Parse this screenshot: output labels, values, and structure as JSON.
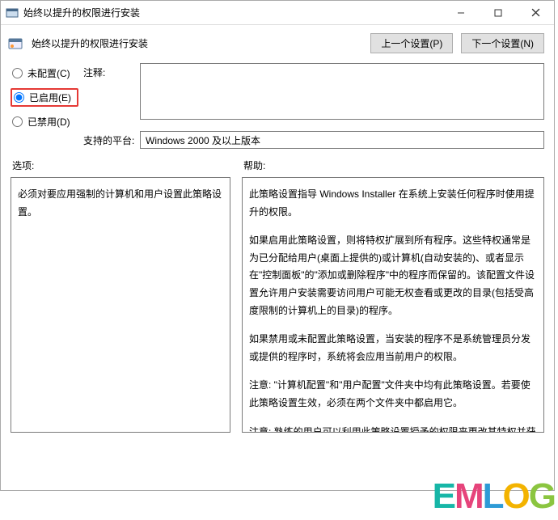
{
  "titlebar": {
    "title": "始终以提升的权限进行安装"
  },
  "header": {
    "title": "始终以提升的权限进行安装",
    "prev_btn": "上一个设置(P)",
    "next_btn": "下一个设置(N)"
  },
  "radios": {
    "not_configured": "未配置(C)",
    "enabled": "已启用(E)",
    "disabled": "已禁用(D)"
  },
  "fields": {
    "comment_label": "注释:",
    "platform_label": "支持的平台:",
    "platform_value": "Windows 2000 及以上版本"
  },
  "panes": {
    "options_label": "选项:",
    "options_text": "必须对要应用强制的计算机和用户设置此策略设置。",
    "help_label": "帮助:",
    "help_p1": "此策略设置指导 Windows Installer 在系统上安装任何程序时使用提升的权限。",
    "help_p2": "如果启用此策略设置，则将特权扩展到所有程序。这些特权通常是为已分配给用户(桌面上提供的)或计算机(自动安装的)、或者显示在\"控制面板\"的\"添加或删除程序\"中的程序而保留的。该配置文件设置允许用户安装需要访问用户可能无权查看或更改的目录(包括受高度限制的计算机上的目录)的程序。",
    "help_p3": "如果禁用或未配置此策略设置，当安装的程序不是系统管理员分发或提供的程序时，系统将会应用当前用户的权限。",
    "help_p4": "注意: \"计算机配置\"和\"用户配置\"文件夹中均有此策略设置。若要使此策略设置生效，必须在两个文件夹中都启用它。",
    "help_p5": "注意: 熟练的用户可以利用此策略设置授予的权限来更改其特权并获得对受限文件和文件夹的永久访问权。请注意，这个策略设置的\"用户配置\"版本不一定安全。"
  },
  "watermark": {
    "e": "E",
    "m": "M",
    "l": "L",
    "o": "O",
    "g": "G"
  }
}
